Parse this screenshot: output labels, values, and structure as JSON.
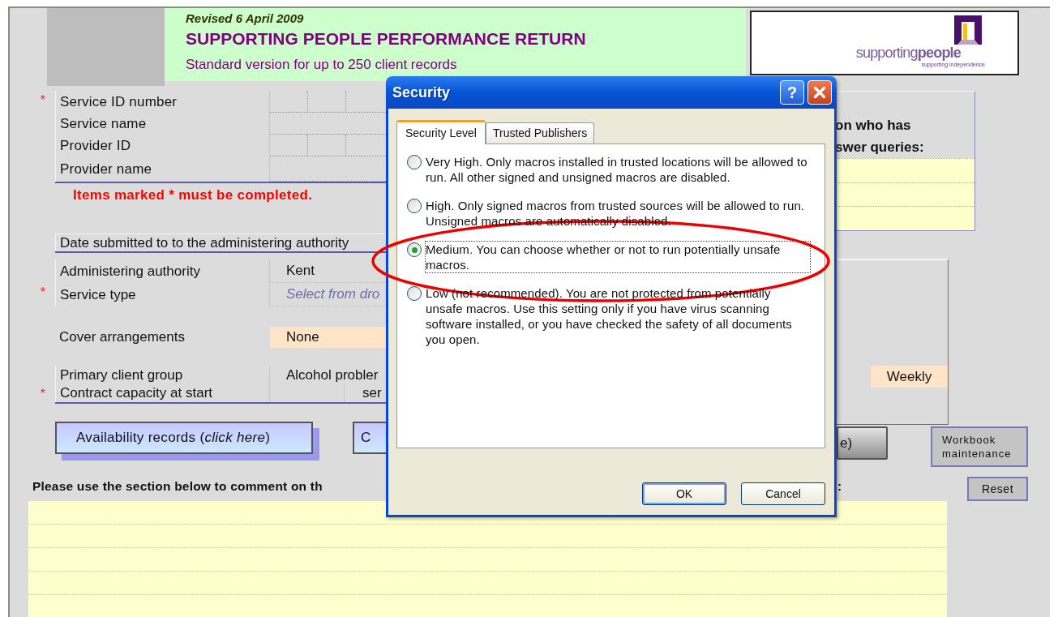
{
  "header": {
    "revised": "Revised 6 April 2009",
    "title": "SUPPORTING PEOPLE PERFORMANCE RETURN",
    "subtitle": "Standard version for up to 250 client records"
  },
  "logo": {
    "wordmark": "supporting**people**",
    "tagline": "supporting independence"
  },
  "service_fields": [
    {
      "label": "Service ID number",
      "required": true,
      "kind": "id"
    },
    {
      "label": "Service name",
      "required": false,
      "kind": "text"
    },
    {
      "label": "Provider ID",
      "required": false,
      "kind": "id"
    },
    {
      "label": "Provider name",
      "required": false,
      "kind": "text"
    }
  ],
  "required_note": "Items marked * must be completed.",
  "required_mark": "*",
  "date_submitted": {
    "label": "Date submitted to to the administering authority"
  },
  "details": [
    {
      "label": "Administering authority",
      "required": false,
      "kind": "plain",
      "value": "Kent"
    },
    {
      "label": "Service type",
      "required": true,
      "kind": "select",
      "placeholder": "Select from dro"
    }
  ],
  "cover": {
    "label": "Cover arrangements",
    "value": "None"
  },
  "client": [
    {
      "label": "Primary client group",
      "required": false,
      "kind": "plain",
      "value": "Alcohol probler"
    },
    {
      "label": "Contract capacity at start",
      "required": true,
      "kind": "split",
      "value": "ser"
    }
  ],
  "left_buttons": [
    {
      "label": "Availability records (*click here*)"
    },
    {
      "label": "C"
    }
  ],
  "contact": {
    "line_1": "on who has",
    "line_2": "swer queries:"
  },
  "frequency": "Weekly",
  "right_buttons": [
    {
      "label": "e)"
    },
    {
      "label": "Workbook maintenance"
    }
  ],
  "comment": {
    "heading": "Please use the section below to comment on th",
    "heading_end": ":"
  },
  "reset_button": "Reset",
  "dialog": {
    "title": "Security",
    "help": "?",
    "tabs": [
      {
        "label": "Security Level",
        "selected": true
      },
      {
        "label": "Trusted Publishers",
        "selected": false
      }
    ],
    "options": [
      {
        "text": "Very High. Only macros installed in trusted locations will be allowed to run. All other signed and unsigned macros are disabled.",
        "selected": false,
        "focused": false
      },
      {
        "text": "High. Only signed macros from trusted sources will be allowed to run. Unsigned macros are automatically disabled.",
        "selected": false,
        "focused": false
      },
      {
        "text": "Medium. You can choose whether or not to run potentially unsafe macros.",
        "selected": true,
        "focused": true
      },
      {
        "text": "Low (not recommended). You are not protected from potentially unsafe macros. Use this setting only if you have virus scanning software installed, or you have checked the safety of all documents you open.",
        "selected": false,
        "focused": false
      }
    ],
    "buttons": [
      {
        "label": "OK",
        "default": true
      },
      {
        "label": "Cancel",
        "default": false
      }
    ]
  }
}
